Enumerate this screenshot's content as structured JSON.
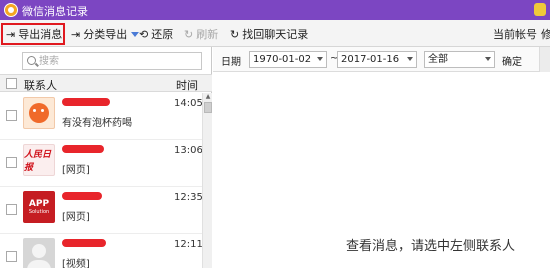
{
  "app": {
    "title": "微信消息记录"
  },
  "toolbar": {
    "export_label": "导出消息",
    "export_by_category_label": "分类导出",
    "restore_label": "还原",
    "refresh_label": "刷新",
    "recover_chats_label": "找回聊天记录",
    "current_account_label": "当前帐号",
    "account_value": "修"
  },
  "search": {
    "placeholder": "搜索"
  },
  "contact_list": {
    "header_contact": "联系人",
    "header_time": "时间",
    "items": [
      {
        "avatar": "orange-mascot-avatar",
        "name_redacted": true,
        "time": "14:05",
        "message": "有没有泡杯药喝"
      },
      {
        "avatar": "people-daily-logo",
        "avatar_text": "人民日报",
        "name_redacted": true,
        "time": "13:06",
        "message": "[网页]"
      },
      {
        "avatar": "app-solution-logo",
        "avatar_text": "APP",
        "avatar_subtext": "Solution",
        "name_redacted": true,
        "time": "12:35",
        "message": "[网页]"
      },
      {
        "avatar": "default-person-avatar",
        "name_redacted": true,
        "time": "12:11",
        "message": "[视频]"
      }
    ]
  },
  "filter": {
    "date_label": "日期",
    "start_date": "1970-01-02",
    "separator": "~",
    "end_date": "2017-01-16",
    "type_value": "全部",
    "confirm_label": "确定"
  },
  "message_area": {
    "empty_text": "查看消息，请选中左侧联系人"
  },
  "colors": {
    "titlebar": "#7c46c2",
    "highlight_box": "#e0191f",
    "redaction": "#e8252b"
  }
}
